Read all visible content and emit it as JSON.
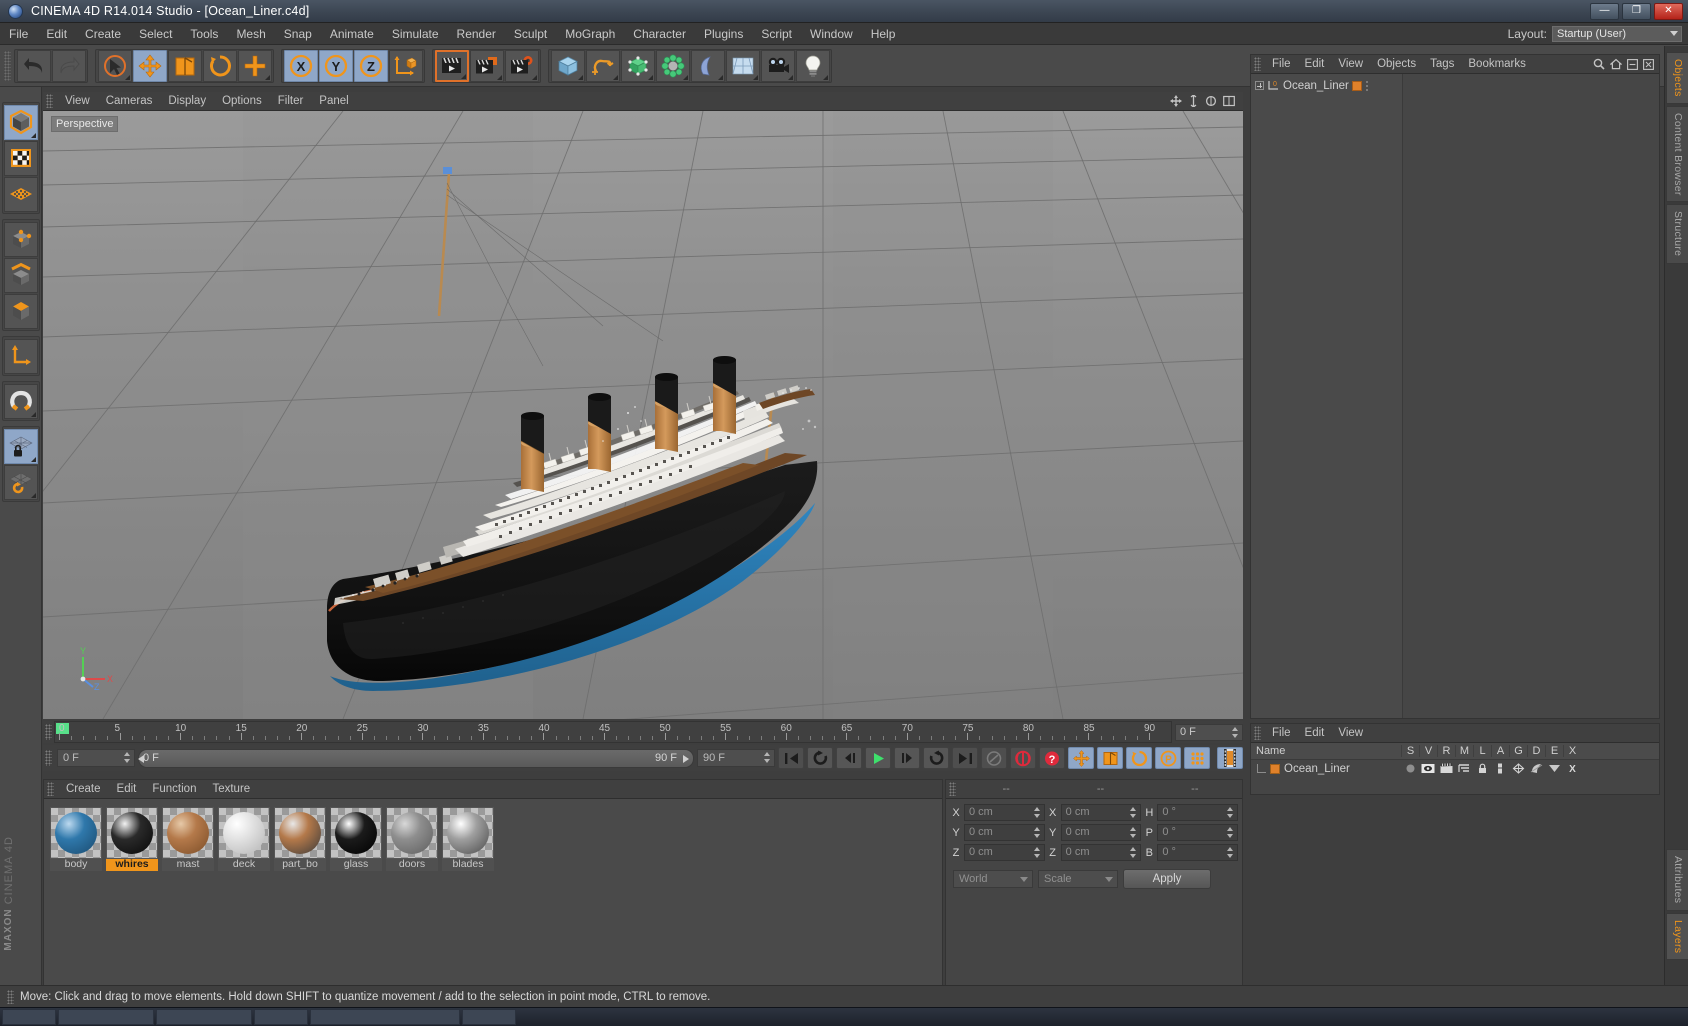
{
  "window": {
    "title": "CINEMA 4D R14.014 Studio - [Ocean_Liner.c4d]",
    "app_icon": "c4d-logo-icon",
    "minimize": "—",
    "maximize": "❐",
    "close": "✕"
  },
  "menubar": {
    "items": [
      "File",
      "Edit",
      "Create",
      "Select",
      "Tools",
      "Mesh",
      "Snap",
      "Animate",
      "Simulate",
      "Render",
      "Sculpt",
      "MoGraph",
      "Character",
      "Plugins",
      "Script",
      "Window",
      "Help"
    ],
    "layout_label": "Layout:",
    "layout_value": "Startup (User)"
  },
  "toolbar": {
    "groups": [
      {
        "name": "undo-redo",
        "buttons": [
          {
            "name": "undo-button",
            "icon": "undo-arrow-icon"
          },
          {
            "name": "redo-button",
            "icon": "redo-arrow-icon"
          }
        ]
      },
      {
        "name": "transform-tools",
        "buttons": [
          {
            "name": "select-tool",
            "icon": "cursor-arrow-icon"
          },
          {
            "name": "move-tool",
            "icon": "move-cross-icon"
          },
          {
            "name": "scale-tool",
            "icon": "scale-box-icon"
          },
          {
            "name": "rotate-tool",
            "icon": "rotate-circle-icon"
          },
          {
            "name": "add-tool",
            "icon": "plus-icon"
          }
        ]
      },
      {
        "name": "axis-locks",
        "buttons": [
          {
            "name": "lock-x-axis",
            "icon": "x-axis-icon",
            "label": "X"
          },
          {
            "name": "lock-y-axis",
            "icon": "y-axis-icon",
            "label": "Y"
          },
          {
            "name": "lock-z-axis",
            "icon": "z-axis-icon",
            "label": "Z"
          },
          {
            "name": "world-object-coord",
            "icon": "world-axis-cube-icon"
          }
        ]
      },
      {
        "name": "render-group",
        "buttons": [
          {
            "name": "render-view",
            "icon": "clapper-render-icon"
          },
          {
            "name": "render-region",
            "icon": "clapper-region-icon"
          },
          {
            "name": "render-settings",
            "icon": "clapper-gear-icon"
          }
        ]
      },
      {
        "name": "create-group",
        "buttons": [
          {
            "name": "add-cube-primitive",
            "icon": "cube-icon"
          },
          {
            "name": "add-spline",
            "icon": "spline-icon"
          },
          {
            "name": "add-generator",
            "icon": "generator-cube-icon"
          },
          {
            "name": "add-deformer",
            "icon": "deformer-icon"
          },
          {
            "name": "add-scene-object",
            "icon": "bend-object-icon"
          },
          {
            "name": "add-environment",
            "icon": "floor-env-icon"
          },
          {
            "name": "add-camera",
            "icon": "camera-icon"
          },
          {
            "name": "add-light",
            "icon": "light-bulb-icon"
          }
        ]
      }
    ]
  },
  "left_toolbar": {
    "buttons": [
      {
        "name": "model-mode",
        "icon": "cube-model-icon"
      },
      {
        "name": "texture-mode",
        "icon": "texture-checker-icon"
      },
      {
        "name": "uv-mesh-mode",
        "icon": "uv-mesh-icon"
      },
      {
        "name": "point-mode",
        "icon": "points-cube-icon"
      },
      {
        "name": "edge-mode",
        "icon": "edge-cube-icon"
      },
      {
        "name": "polygon-mode",
        "icon": "polygon-cube-icon"
      },
      {
        "name": "axis-mode",
        "icon": "axis-arrows-icon"
      },
      {
        "name": "enable-snap",
        "icon": "magnet-icon"
      },
      {
        "name": "workplane-lock",
        "icon": "grid-lock-icon"
      },
      {
        "name": "workplane-rotate",
        "icon": "grid-rotate-icon"
      }
    ],
    "brand_line1": "MAXON",
    "brand_line2": "CINEMA 4D"
  },
  "viewport": {
    "menu": [
      "View",
      "Cameras",
      "Display",
      "Options",
      "Filter",
      "Panel"
    ],
    "label": "Perspective",
    "axis_labels": {
      "y": "Y",
      "x": "X",
      "z": "Z"
    },
    "corner_icons": [
      "viewport-move-icon",
      "viewport-scale-icon",
      "viewport-rotate-icon",
      "viewport-maximize-icon"
    ],
    "scene": {
      "object": "Ocean_Liner",
      "colors": {
        "hull_black": "#151515",
        "hull_blue": "#2a78ad",
        "deck_brown": "#6e4726",
        "superstructure_white": "#e8e6e2",
        "funnel_tan": "#c6884a",
        "funnel_top_black": "#171717",
        "mast_tan": "#b98a50",
        "boot_stripe": "#c8643a",
        "ground": "#8a8a8a",
        "grid_line": "#6f6f6f"
      }
    }
  },
  "timeline": {
    "ruler_min": 0,
    "ruler_max": 90,
    "major_step": 5,
    "tick_labels": [
      "0",
      "5",
      "10",
      "15",
      "20",
      "25",
      "30",
      "35",
      "40",
      "45",
      "50",
      "55",
      "60",
      "65",
      "70",
      "75",
      "80",
      "85",
      "90"
    ],
    "current_frame": "0 F",
    "playhead_frame": 0
  },
  "playbar": {
    "start_field": "0 F",
    "track_start": "0 F",
    "track_end": "90 F",
    "end_field": "90 F",
    "buttons": [
      {
        "name": "go-to-start-button",
        "icon": "skip-start-icon"
      },
      {
        "name": "previous-key-button",
        "icon": "prev-key-icon"
      },
      {
        "name": "step-back-button",
        "icon": "step-back-icon"
      },
      {
        "name": "play-button",
        "icon": "play-triangle-icon"
      },
      {
        "name": "step-forward-button",
        "icon": "step-forward-icon"
      },
      {
        "name": "next-key-button",
        "icon": "next-key-icon"
      },
      {
        "name": "go-to-end-button",
        "icon": "skip-end-icon"
      },
      {
        "name": "autokey-toggle",
        "icon": "record-auto-icon"
      },
      {
        "name": "record-active-objects",
        "icon": "record-circle-icon"
      },
      {
        "name": "keyframe-selection",
        "icon": "keyframe-question-icon"
      },
      {
        "name": "record-position",
        "icon": "position-move-icon"
      },
      {
        "name": "record-scale",
        "icon": "scale-record-icon"
      },
      {
        "name": "record-rotation",
        "icon": "rotation-record-icon"
      },
      {
        "name": "record-pla",
        "icon": "pla-circle-icon"
      },
      {
        "name": "record-parameter",
        "icon": "param-dots-icon"
      },
      {
        "name": "timeline-filmstrip",
        "icon": "filmstrip-icon"
      }
    ]
  },
  "material_manager": {
    "menu": [
      "Create",
      "Edit",
      "Function",
      "Texture"
    ],
    "selected": "whires",
    "materials": [
      {
        "name": "body",
        "color1": "#2f78ab",
        "color2": "#1a4a6e",
        "highlight": "#bcd9ef"
      },
      {
        "name": "whires",
        "color1": "#2a2a2a",
        "color2": "#070707",
        "highlight": "#f2f2f2"
      },
      {
        "name": "mast",
        "color1": "#b4794a",
        "color2": "#7b4d27",
        "highlight": "#e6c9a8"
      },
      {
        "name": "deck",
        "color1": "#e2e2e2",
        "color2": "#b4b4b4",
        "highlight": "#ffffff"
      },
      {
        "name": "part_bo",
        "color1": "#b4794a",
        "color2": "#3a3a3a",
        "highlight": "#e8e8e8"
      },
      {
        "name": "glass",
        "color1": "#1b1b1b",
        "color2": "#000000",
        "highlight": "#ffffff"
      },
      {
        "name": "doors",
        "color1": "#8e8e8e",
        "color2": "#5d5d5d",
        "highlight": "#d8d8d8"
      },
      {
        "name": "blades",
        "color1": "#9f9f9f",
        "color2": "#4a4a4a",
        "highlight": "#ffffff"
      }
    ]
  },
  "coordinates": {
    "headers": [
      "--",
      "--",
      "--"
    ],
    "rows": [
      {
        "pos_axis": "X",
        "pos_value": "0 cm",
        "size_axis": "X",
        "size_value": "0 cm",
        "rot_axis": "H",
        "rot_value": "0 °"
      },
      {
        "pos_axis": "Y",
        "pos_value": "0 cm",
        "size_axis": "Y",
        "size_value": "0 cm",
        "rot_axis": "P",
        "rot_value": "0 °"
      },
      {
        "pos_axis": "Z",
        "pos_value": "0 cm",
        "size_axis": "Z",
        "size_value": "0 cm",
        "rot_axis": "B",
        "rot_value": "0 °"
      }
    ],
    "coord_system": "World",
    "mode": "Scale",
    "apply_label": "Apply"
  },
  "object_manager": {
    "menu": [
      "File",
      "Edit",
      "View",
      "Objects",
      "Tags",
      "Bookmarks"
    ],
    "header_icons": [
      "search-icon",
      "home-icon",
      "collapse-icon",
      "close-icon"
    ],
    "objects": [
      {
        "name": "Ocean_Liner",
        "level": 0,
        "has_children": true,
        "tag": "material-tag"
      }
    ]
  },
  "layer_manager": {
    "menu": [
      "File",
      "Edit",
      "View"
    ],
    "columns": [
      "Name",
      "S",
      "V",
      "R",
      "M",
      "L",
      "A",
      "G",
      "D",
      "E",
      "X"
    ],
    "rows": [
      {
        "name": "Ocean_Liner",
        "color": "#e0812a"
      }
    ]
  },
  "right_tabs": {
    "top": [
      {
        "label": "Objects",
        "active": true
      },
      {
        "label": "Content Browser",
        "active": false
      },
      {
        "label": "Structure",
        "active": false
      }
    ],
    "bottom": [
      {
        "label": "Attributes",
        "active": false
      },
      {
        "label": "Layers",
        "active": true
      }
    ]
  },
  "statusbar": {
    "message": "Move: Click and drag to move elements. Hold down SHIFT to quantize movement / add to the selection in point mode, CTRL to remove."
  },
  "theme": {
    "accent_orange": "#e0812a",
    "selection_blue": "#8fa7c8",
    "panel_bg": "#454545",
    "toolbar_bg": "#4a4a4a"
  }
}
